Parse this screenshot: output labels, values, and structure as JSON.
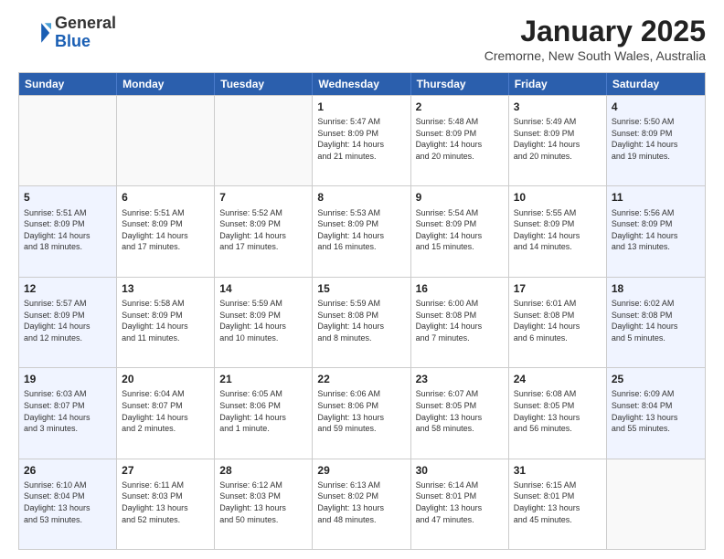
{
  "logo": {
    "general": "General",
    "blue": "Blue"
  },
  "header": {
    "month": "January 2025",
    "location": "Cremorne, New South Wales, Australia"
  },
  "weekdays": [
    "Sunday",
    "Monday",
    "Tuesday",
    "Wednesday",
    "Thursday",
    "Friday",
    "Saturday"
  ],
  "weeks": [
    [
      {
        "day": "",
        "info": ""
      },
      {
        "day": "",
        "info": ""
      },
      {
        "day": "",
        "info": ""
      },
      {
        "day": "1",
        "info": "Sunrise: 5:47 AM\nSunset: 8:09 PM\nDaylight: 14 hours\nand 21 minutes."
      },
      {
        "day": "2",
        "info": "Sunrise: 5:48 AM\nSunset: 8:09 PM\nDaylight: 14 hours\nand 20 minutes."
      },
      {
        "day": "3",
        "info": "Sunrise: 5:49 AM\nSunset: 8:09 PM\nDaylight: 14 hours\nand 20 minutes."
      },
      {
        "day": "4",
        "info": "Sunrise: 5:50 AM\nSunset: 8:09 PM\nDaylight: 14 hours\nand 19 minutes."
      }
    ],
    [
      {
        "day": "5",
        "info": "Sunrise: 5:51 AM\nSunset: 8:09 PM\nDaylight: 14 hours\nand 18 minutes."
      },
      {
        "day": "6",
        "info": "Sunrise: 5:51 AM\nSunset: 8:09 PM\nDaylight: 14 hours\nand 17 minutes."
      },
      {
        "day": "7",
        "info": "Sunrise: 5:52 AM\nSunset: 8:09 PM\nDaylight: 14 hours\nand 17 minutes."
      },
      {
        "day": "8",
        "info": "Sunrise: 5:53 AM\nSunset: 8:09 PM\nDaylight: 14 hours\nand 16 minutes."
      },
      {
        "day": "9",
        "info": "Sunrise: 5:54 AM\nSunset: 8:09 PM\nDaylight: 14 hours\nand 15 minutes."
      },
      {
        "day": "10",
        "info": "Sunrise: 5:55 AM\nSunset: 8:09 PM\nDaylight: 14 hours\nand 14 minutes."
      },
      {
        "day": "11",
        "info": "Sunrise: 5:56 AM\nSunset: 8:09 PM\nDaylight: 14 hours\nand 13 minutes."
      }
    ],
    [
      {
        "day": "12",
        "info": "Sunrise: 5:57 AM\nSunset: 8:09 PM\nDaylight: 14 hours\nand 12 minutes."
      },
      {
        "day": "13",
        "info": "Sunrise: 5:58 AM\nSunset: 8:09 PM\nDaylight: 14 hours\nand 11 minutes."
      },
      {
        "day": "14",
        "info": "Sunrise: 5:59 AM\nSunset: 8:09 PM\nDaylight: 14 hours\nand 10 minutes."
      },
      {
        "day": "15",
        "info": "Sunrise: 5:59 AM\nSunset: 8:08 PM\nDaylight: 14 hours\nand 8 minutes."
      },
      {
        "day": "16",
        "info": "Sunrise: 6:00 AM\nSunset: 8:08 PM\nDaylight: 14 hours\nand 7 minutes."
      },
      {
        "day": "17",
        "info": "Sunrise: 6:01 AM\nSunset: 8:08 PM\nDaylight: 14 hours\nand 6 minutes."
      },
      {
        "day": "18",
        "info": "Sunrise: 6:02 AM\nSunset: 8:08 PM\nDaylight: 14 hours\nand 5 minutes."
      }
    ],
    [
      {
        "day": "19",
        "info": "Sunrise: 6:03 AM\nSunset: 8:07 PM\nDaylight: 14 hours\nand 3 minutes."
      },
      {
        "day": "20",
        "info": "Sunrise: 6:04 AM\nSunset: 8:07 PM\nDaylight: 14 hours\nand 2 minutes."
      },
      {
        "day": "21",
        "info": "Sunrise: 6:05 AM\nSunset: 8:06 PM\nDaylight: 14 hours\nand 1 minute."
      },
      {
        "day": "22",
        "info": "Sunrise: 6:06 AM\nSunset: 8:06 PM\nDaylight: 13 hours\nand 59 minutes."
      },
      {
        "day": "23",
        "info": "Sunrise: 6:07 AM\nSunset: 8:05 PM\nDaylight: 13 hours\nand 58 minutes."
      },
      {
        "day": "24",
        "info": "Sunrise: 6:08 AM\nSunset: 8:05 PM\nDaylight: 13 hours\nand 56 minutes."
      },
      {
        "day": "25",
        "info": "Sunrise: 6:09 AM\nSunset: 8:04 PM\nDaylight: 13 hours\nand 55 minutes."
      }
    ],
    [
      {
        "day": "26",
        "info": "Sunrise: 6:10 AM\nSunset: 8:04 PM\nDaylight: 13 hours\nand 53 minutes."
      },
      {
        "day": "27",
        "info": "Sunrise: 6:11 AM\nSunset: 8:03 PM\nDaylight: 13 hours\nand 52 minutes."
      },
      {
        "day": "28",
        "info": "Sunrise: 6:12 AM\nSunset: 8:03 PM\nDaylight: 13 hours\nand 50 minutes."
      },
      {
        "day": "29",
        "info": "Sunrise: 6:13 AM\nSunset: 8:02 PM\nDaylight: 13 hours\nand 48 minutes."
      },
      {
        "day": "30",
        "info": "Sunrise: 6:14 AM\nSunset: 8:01 PM\nDaylight: 13 hours\nand 47 minutes."
      },
      {
        "day": "31",
        "info": "Sunrise: 6:15 AM\nSunset: 8:01 PM\nDaylight: 13 hours\nand 45 minutes."
      },
      {
        "day": "",
        "info": ""
      }
    ]
  ]
}
